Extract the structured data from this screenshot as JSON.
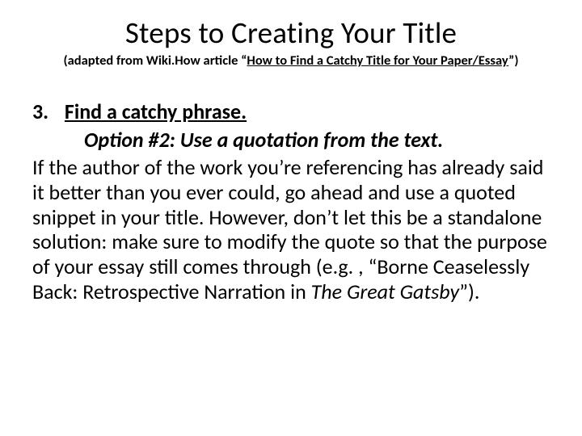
{
  "header": {
    "title": "Steps to Creating Your Title",
    "subtitle_prefix": "(adapted from Wiki.How article “",
    "subtitle_link": "How to Find a Catchy Title for Your Paper/Essay",
    "subtitle_suffix": "”)"
  },
  "step": {
    "number": "3.",
    "heading": "Find a catchy phrase.",
    "option_label": "Option #2: Use a quotation from the text.",
    "body_before_italic": "If the author of the work you’re referencing has already said it better than you ever could, go ahead and use a quoted snippet in your title. However, don’t let this be a standalone solution: make sure to modify the quote so that the purpose of your essay still comes through (e.g. , “Borne Ceaselessly Back: Retrospective Narration in ",
    "body_italic": "The Great Gatsby",
    "body_after_italic": "”)."
  }
}
